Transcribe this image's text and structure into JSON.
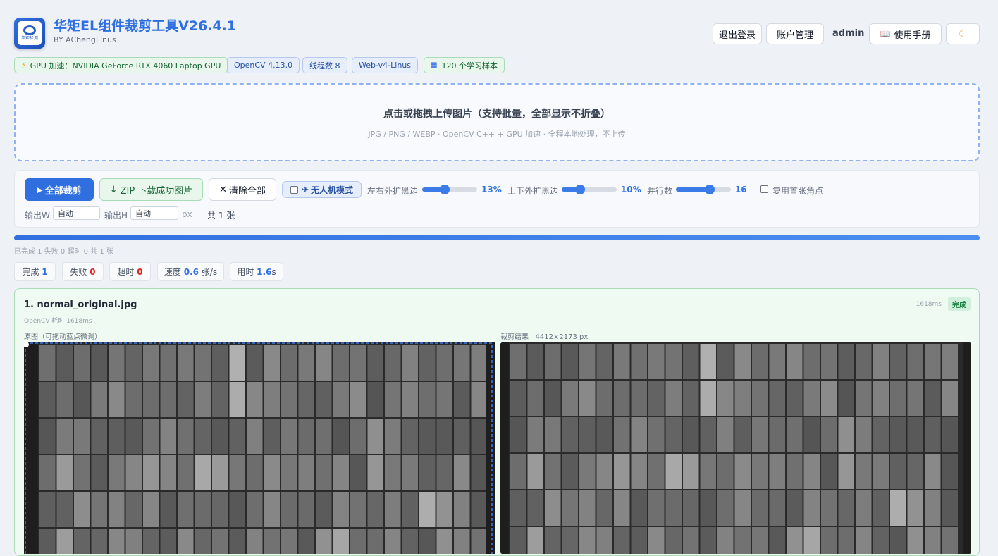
{
  "header": {
    "title": "华矩EL组件裁剪工具V26.4.1",
    "subtitle": "BY AChengLinus",
    "logo_text": "华矩检测",
    "logout": "退出登录",
    "account": "账户管理",
    "user": "admin",
    "manual": "使用手册",
    "manual_icon": "book-icon",
    "theme_icon": "moon-icon"
  },
  "badges": [
    {
      "icon": "lightning-icon",
      "text": "GPU 加速：NVIDIA GeForce RTX 4060 Laptop GPU"
    },
    {
      "text": "OpenCV 4.13.0"
    },
    {
      "text": "线程数 8"
    },
    {
      "text": "Web-v4-Linus"
    },
    {
      "icon": "chart-icon",
      "text": "120 个学习样本"
    }
  ],
  "upload": {
    "title": "点击或拖拽上传图片（支持批量，全部显示不折叠）",
    "subtitle": "JPG / PNG / WEBP  ·  OpenCV C++ + GPU 加速  ·  全程本地处理，不上传"
  },
  "toolbar": {
    "crop_all": "全部裁剪",
    "zip_download": "ZIP 下载成功图片",
    "clear_all": "清除全部",
    "drone_mode": "无人机模式",
    "lr_label": "左右外扩黑边",
    "lr_value": "13%",
    "lr_fraction": 0.41,
    "tb_label": "上下外扩黑边",
    "tb_value": "10%",
    "tb_fraction": 0.33,
    "parallel_label": "并行数",
    "parallel_value": "16",
    "parallel_fraction": 0.62,
    "reuse_label": "复用首张角点",
    "out_w_label": "输出W",
    "out_w_value": "自动",
    "out_h_label": "输出H",
    "out_h_value": "自动",
    "unit": "px",
    "total": "共 1 张"
  },
  "progress": {
    "fraction": 1.0,
    "text": "已完成 1 失败 0 超时 0 共 1 张"
  },
  "stats": [
    {
      "label": "完成",
      "value": "1",
      "unit": ""
    },
    {
      "label": "失败",
      "value": "0",
      "unit": ""
    },
    {
      "label": "超时",
      "value": "0",
      "unit": ""
    },
    {
      "label": "速度",
      "value": "0.6",
      "unit": "张/s"
    },
    {
      "label": "用时",
      "value": "1.6",
      "unit": "s"
    }
  ],
  "result": {
    "title": "1. normal_original.jpg",
    "meta": "OpenCV 耗时 1618ms",
    "time": "1618ms",
    "status": "完成",
    "left_label": "原图（可拖动蓝点微调）",
    "right_label": "裁剪结果",
    "right_size": "4412×2173 px"
  },
  "colors": {
    "accent": "#2f6fe0",
    "success": "#15803d",
    "danger": "#dc2626"
  }
}
